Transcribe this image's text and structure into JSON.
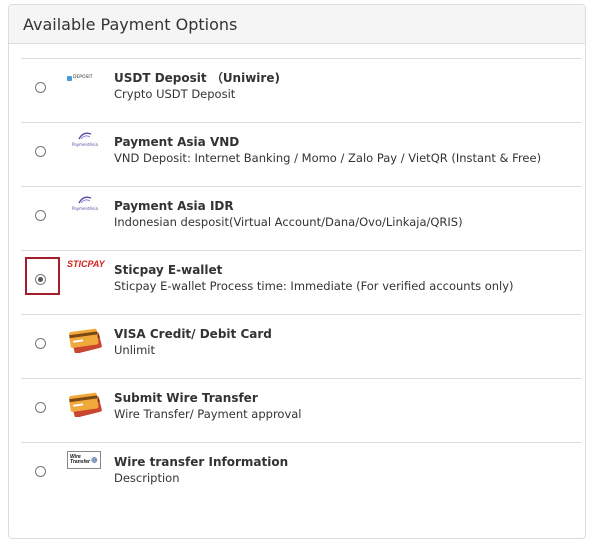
{
  "panel": {
    "title": "Available Payment Options"
  },
  "options": [
    {
      "title": "USDT Deposit （Uniwire)",
      "description": "Crypto USDT Deposit",
      "logo": "usdt-deposit-logo",
      "logo_text": "DEPOSIT",
      "selected": false
    },
    {
      "title": "Payment Asia VND",
      "description": "VND Deposit: Internet Banking / Momo / Zalo Pay / VietQR (Instant & Free)",
      "logo": "payment-asia-logo",
      "logo_text": "PaymentAsia",
      "selected": false
    },
    {
      "title": "Payment Asia IDR",
      "description": "Indonesian desposit(Virtual Account/Dana/Ovo/Linkaja/QRIS)",
      "logo": "payment-asia-logo",
      "logo_text": "PaymentAsia",
      "selected": false
    },
    {
      "title": "Sticpay E-wallet",
      "description": "Sticpay E-wallet Process time: Immediate (For verified accounts only)",
      "logo": "sticpay-logo",
      "logo_text": "STICPAY",
      "selected": true
    },
    {
      "title": "VISA Credit/ Debit Card",
      "description": "Unlimit",
      "logo": "credit-card-logo",
      "selected": false
    },
    {
      "title": "Submit Wire Transfer",
      "description": "Wire Transfer/ Payment approval",
      "logo": "credit-card-logo",
      "selected": false
    },
    {
      "title": "Wire transfer Information",
      "description": "Description",
      "logo": "wire-transfer-logo",
      "logo_text": "Wire Transfer",
      "selected": false
    }
  ],
  "colors": {
    "highlight_border": "#a31d2c",
    "sticpay_red": "#d32420",
    "header_bg": "#f5f5f5"
  }
}
